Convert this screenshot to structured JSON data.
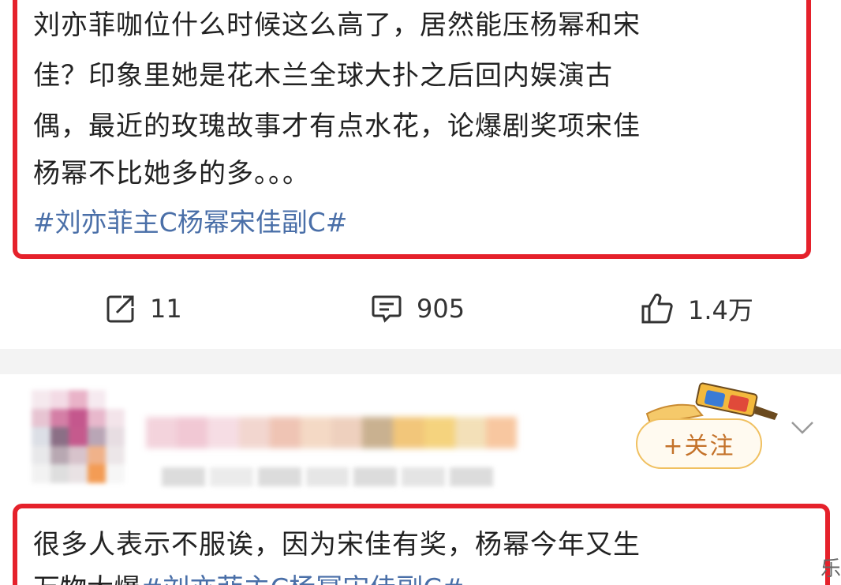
{
  "post1": {
    "lines": [
      "刘亦菲咖位什么时候这么高了，居然能压杨幂和宋",
      "佳？印象里她是花木兰全球大扑之后回内娱演古",
      "偶，最近的玫瑰故事才有点水花，论爆剧奖项宋佳",
      "杨幂不比她多的多。。。"
    ],
    "hashtag": "#刘亦菲主C杨幂宋佳副C#",
    "actions": {
      "repost_count": "11",
      "comment_count": "905",
      "like_count": "1.4万"
    }
  },
  "post2": {
    "follow_label": "+关注",
    "line1": "很多人表示不服诶，因为宋佳有奖，杨幂今年又生",
    "line2_text": "万物大爆",
    "line2_tag": "#刘亦菲主C杨幂宋佳副C#"
  },
  "edge_glyph": "乐",
  "icons": {
    "repost": "repost-icon",
    "comment": "comment-icon",
    "like": "thumbs-up-icon",
    "more": "chevron-down-icon",
    "decoration": "3d-glasses-badge-icon"
  },
  "colors": {
    "highlight": "#e5212b",
    "hashtag": "#4a6fa8",
    "follow_text": "#c4722a",
    "follow_border": "#f0c060",
    "separator": "#f3f3f3"
  }
}
